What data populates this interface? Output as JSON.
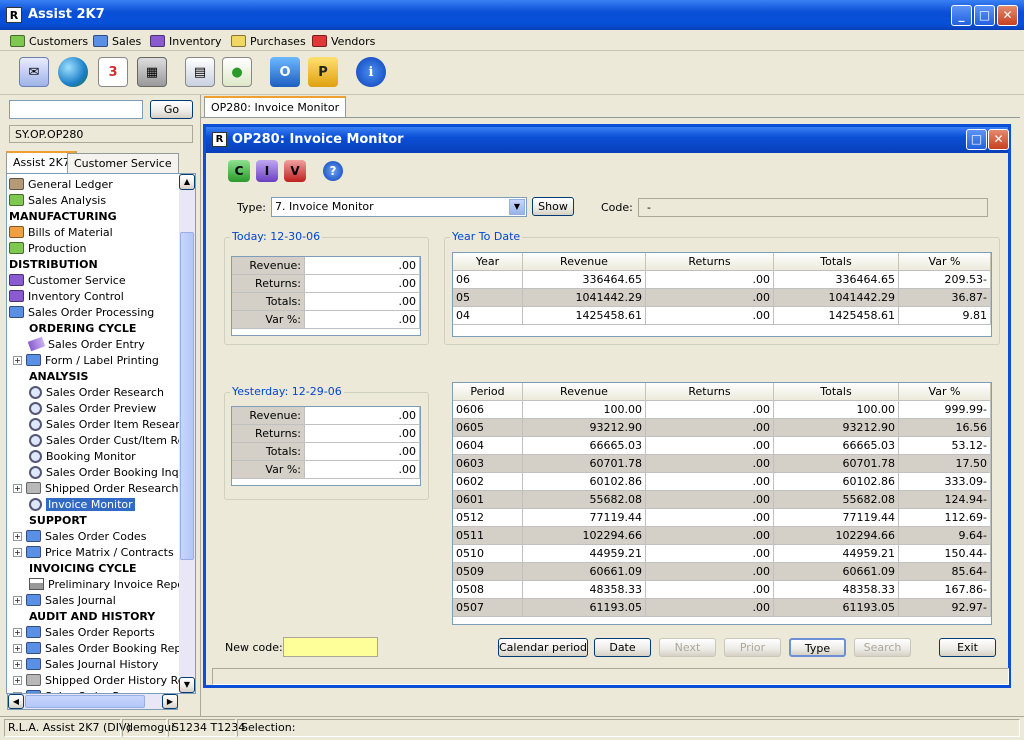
{
  "app": {
    "title": "Assist 2K7"
  },
  "menu": [
    {
      "label": "Customers",
      "color": "#7ec850"
    },
    {
      "label": "Sales",
      "color": "#5a8fe6"
    },
    {
      "label": "Inventory",
      "color": "#8a5bd0"
    },
    {
      "label": "Purchases",
      "color": "#f0d860"
    },
    {
      "label": "Vendors",
      "color": "#e03838"
    }
  ],
  "toolbar": {
    "icons": [
      "mail-icon",
      "globe-icon",
      "calendar-icon",
      "calculator-icon",
      "address-book-icon",
      "report-icon",
      "outlook-icon",
      "p-app-icon",
      "info-icon"
    ],
    "calendar_glyph": "3",
    "o_glyph": "O",
    "p_glyph": "P",
    "info_glyph": "i"
  },
  "left": {
    "search_value": "",
    "go_label": "Go",
    "path": "SY.OP.OP280",
    "tabs": [
      "Assist 2K7",
      "Customer Service"
    ]
  },
  "tree": [
    {
      "label": "General Ledger",
      "type": "folder",
      "color": "#b59a7a",
      "level": 0
    },
    {
      "label": "Sales Analysis",
      "type": "folder",
      "color": "#7ec850",
      "level": 0
    },
    {
      "label": "MANUFACTURING",
      "type": "header",
      "level": 0
    },
    {
      "label": "Bills of Material",
      "type": "folder",
      "color": "#f0a040",
      "level": 0
    },
    {
      "label": "Production",
      "type": "folder",
      "color": "#7ec850",
      "level": 0
    },
    {
      "label": "DISTRIBUTION",
      "type": "header",
      "level": 0
    },
    {
      "label": "Customer Service",
      "type": "folder",
      "color": "#8a5bd0",
      "level": 0
    },
    {
      "label": "Inventory Control",
      "type": "folder",
      "color": "#8a5bd0",
      "level": 0
    },
    {
      "label": "Sales Order Processing",
      "type": "folder",
      "color": "#5a8fe6",
      "level": 0
    },
    {
      "label": "ORDERING CYCLE",
      "type": "header",
      "level": 1
    },
    {
      "label": "Sales Order Entry",
      "type": "pen",
      "level": 1
    },
    {
      "label": "Form / Label Printing",
      "type": "folder",
      "color": "#5a8fe6",
      "level": 1,
      "plus": true
    },
    {
      "label": "ANALYSIS",
      "type": "header",
      "level": 1
    },
    {
      "label": "Sales Order Research",
      "type": "mag",
      "level": 1
    },
    {
      "label": "Sales Order Preview",
      "type": "mag",
      "level": 1
    },
    {
      "label": "Sales Order Item Research",
      "type": "mag",
      "level": 1
    },
    {
      "label": "Sales Order Cust/Item Res",
      "type": "mag",
      "level": 1
    },
    {
      "label": "Booking Monitor",
      "type": "mag",
      "level": 1
    },
    {
      "label": "Sales Order Booking Inquir",
      "type": "mag",
      "level": 1
    },
    {
      "label": "Shipped Order Researches",
      "type": "folder",
      "color": "#b8b8b8",
      "level": 1,
      "plus": true
    },
    {
      "label": "Invoice Monitor",
      "type": "mag",
      "level": 1,
      "selected": true
    },
    {
      "label": "SUPPORT",
      "type": "header",
      "level": 1
    },
    {
      "label": "Sales Order Codes",
      "type": "folder",
      "color": "#5a8fe6",
      "level": 1,
      "plus": true
    },
    {
      "label": "Price Matrix / Contracts",
      "type": "folder",
      "color": "#5a8fe6",
      "level": 1,
      "plus": true
    },
    {
      "label": "INVOICING CYCLE",
      "type": "header",
      "level": 1
    },
    {
      "label": "Preliminary Invoice Report",
      "type": "printer",
      "level": 1
    },
    {
      "label": "Sales Journal",
      "type": "folder",
      "color": "#5a8fe6",
      "level": 1,
      "plus": true
    },
    {
      "label": "AUDIT AND HISTORY",
      "type": "header",
      "level": 1
    },
    {
      "label": "Sales Order Reports",
      "type": "folder",
      "color": "#5a8fe6",
      "level": 1,
      "plus": true
    },
    {
      "label": "Sales Order Booking Repor",
      "type": "folder",
      "color": "#5a8fe6",
      "level": 1,
      "plus": true
    },
    {
      "label": "Sales Journal History",
      "type": "folder",
      "color": "#5a8fe6",
      "level": 1,
      "plus": true
    },
    {
      "label": "Shipped Order History Rep",
      "type": "folder",
      "color": "#b8b8b8",
      "level": 1,
      "plus": true
    },
    {
      "label": "Sales Order Purge",
      "type": "folder",
      "color": "#5a8fe6",
      "level": 1,
      "plus": true
    }
  ],
  "workspace": {
    "tab": "OP280: Invoice Monitor"
  },
  "window": {
    "title": "OP280: Invoice Monitor",
    "app_logo_glyph": "R",
    "tool_glyphs": {
      "c": "C",
      "i": "I",
      "v": "V",
      "help": "?"
    },
    "type_label": "Type:",
    "type_value": "7. Invoice Monitor",
    "show_label": "Show",
    "code_label": "Code:",
    "code_value": "-",
    "today": {
      "label": "Today: 12-30-06",
      "rows": [
        [
          "Revenue:",
          ".00"
        ],
        [
          "Returns:",
          ".00"
        ],
        [
          "Totals:",
          ".00"
        ],
        [
          "Var %:",
          ".00"
        ]
      ]
    },
    "yesterday": {
      "label": "Yesterday: 12-29-06",
      "rows": [
        [
          "Revenue:",
          ".00"
        ],
        [
          "Returns:",
          ".00"
        ],
        [
          "Totals:",
          ".00"
        ],
        [
          "Var %:",
          ".00"
        ]
      ]
    },
    "ytd": {
      "label": "Year To Date",
      "columns": [
        "Year",
        "Revenue",
        "Returns",
        "Totals",
        "Var %"
      ],
      "rows": [
        [
          "06",
          "336464.65",
          ".00",
          "336464.65",
          "209.53-"
        ],
        [
          "05",
          "1041442.29",
          ".00",
          "1041442.29",
          "36.87-"
        ],
        [
          "04",
          "1425458.61",
          ".00",
          "1425458.61",
          "9.81"
        ]
      ]
    },
    "period": {
      "columns": [
        "Period",
        "Revenue",
        "Returns",
        "Totals",
        "Var %"
      ],
      "rows": [
        [
          "0606",
          "100.00",
          ".00",
          "100.00",
          "999.99-"
        ],
        [
          "0605",
          "93212.90",
          ".00",
          "93212.90",
          "16.56"
        ],
        [
          "0604",
          "66665.03",
          ".00",
          "66665.03",
          "53.12-"
        ],
        [
          "0603",
          "60701.78",
          ".00",
          "60701.78",
          "17.50"
        ],
        [
          "0602",
          "60102.86",
          ".00",
          "60102.86",
          "333.09-"
        ],
        [
          "0601",
          "55682.08",
          ".00",
          "55682.08",
          "124.94-"
        ],
        [
          "0512",
          "77119.44",
          ".00",
          "77119.44",
          "112.69-"
        ],
        [
          "0511",
          "102294.66",
          ".00",
          "102294.66",
          "9.64-"
        ],
        [
          "0510",
          "44959.21",
          ".00",
          "44959.21",
          "150.44-"
        ],
        [
          "0509",
          "60661.09",
          ".00",
          "60661.09",
          "85.64-"
        ],
        [
          "0508",
          "48358.33",
          ".00",
          "48358.33",
          "167.86-"
        ],
        [
          "0507",
          "61193.05",
          ".00",
          "61193.05",
          "92.97-"
        ]
      ]
    },
    "new_code_label": "New code:",
    "new_code_value": "",
    "buttons": [
      {
        "label": "Calendar period",
        "enabled": true
      },
      {
        "label": "Date",
        "enabled": true
      },
      {
        "label": "Next",
        "enabled": false
      },
      {
        "label": "Prior",
        "enabled": false
      },
      {
        "label": "Type",
        "enabled": true
      },
      {
        "label": "Search",
        "enabled": false
      },
      {
        "label": "Exit",
        "enabled": true
      }
    ]
  },
  "status": [
    "R.L.A. Assist 2K7 (DIV)",
    "demogui",
    "S1234 T1234",
    "Selection:"
  ]
}
